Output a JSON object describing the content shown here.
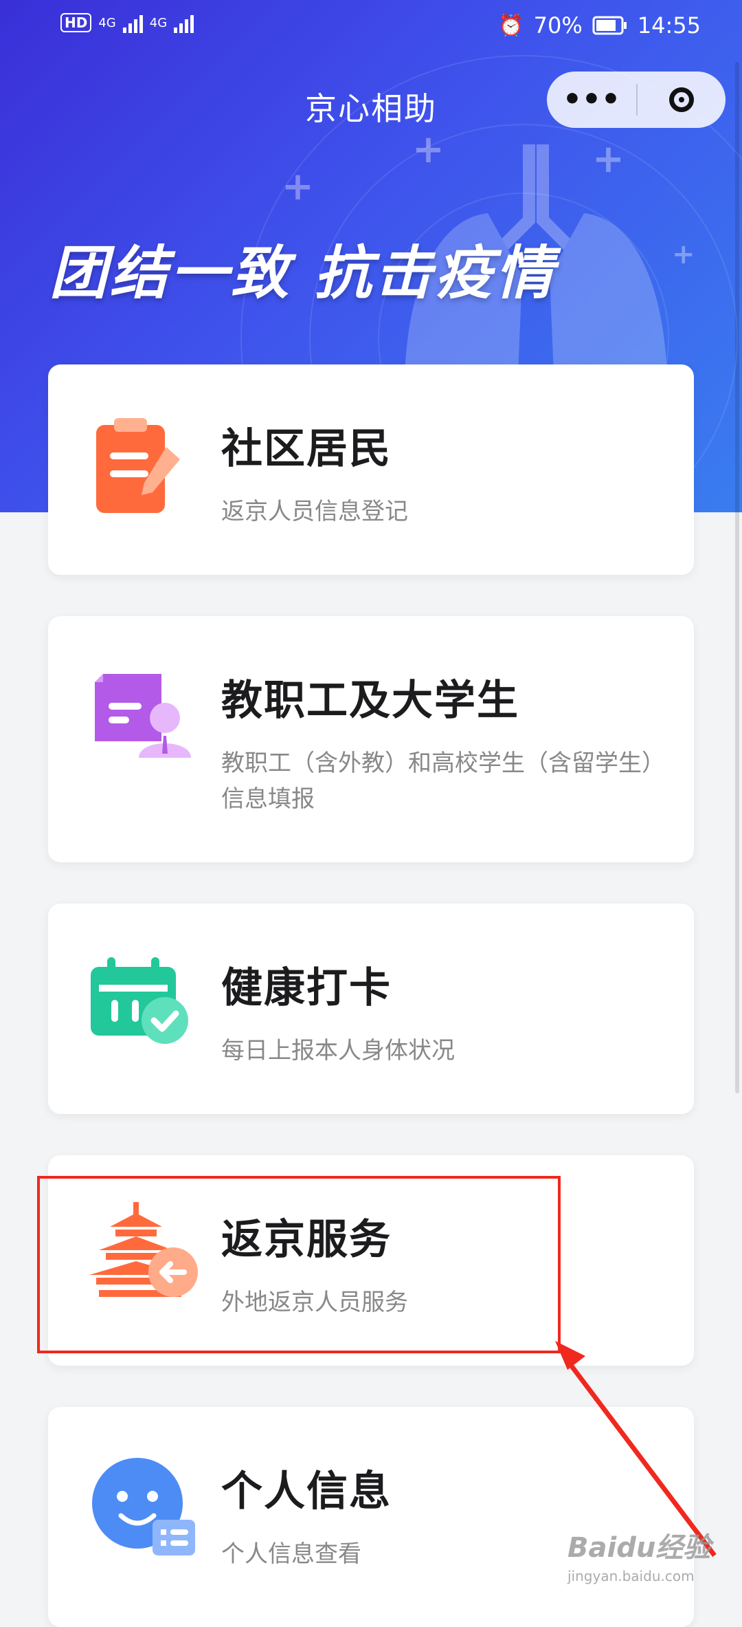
{
  "status_bar": {
    "hd": "HD",
    "net1": "4G",
    "net2": "4G",
    "battery": "70%",
    "time": "14:55"
  },
  "app": {
    "title": "京心相助",
    "more_icon": "more-dots-icon",
    "close_icon": "mini-program-close-icon"
  },
  "banner": {
    "slogan": "团结一致 抗击疫情"
  },
  "cards": [
    {
      "title": "社区居民",
      "desc": "返京人员信息登记",
      "icon": "clipboard-pen-icon",
      "color": "#ff6a3d"
    },
    {
      "title": "教职工及大学生",
      "desc": "教职工（含外教）和高校学生（含留学生）信息填报",
      "icon": "id-card-person-icon",
      "color": "#b35ae8"
    },
    {
      "title": "健康打卡",
      "desc": "每日上报本人身体状况",
      "icon": "calendar-check-icon",
      "color": "#22c79a"
    },
    {
      "title": "返京服务",
      "desc": "外地返京人员服务",
      "icon": "temple-return-icon",
      "color": "#ff6a3d"
    },
    {
      "title": "个人信息",
      "desc": "个人信息查看",
      "icon": "smiley-profile-icon",
      "color": "#4d8cf5"
    }
  ],
  "annotation": {
    "color": "#f0281e"
  },
  "watermark": {
    "brand": "Baidu经验",
    "url": "jingyan.baidu.com"
  }
}
